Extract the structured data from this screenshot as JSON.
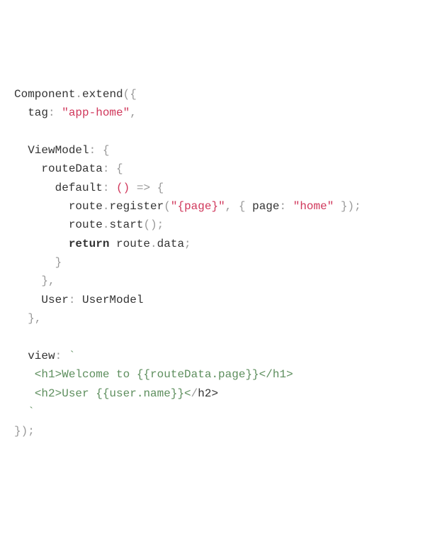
{
  "code": {
    "l1": {
      "a": "Component",
      "b": ".",
      "c": "extend",
      "d": "(",
      "e": "{"
    },
    "l2": {
      "a": "  tag",
      "b": ": ",
      "c": "\"app-home\"",
      "d": ","
    },
    "l3": "",
    "l4": {
      "a": "  ViewModel",
      "b": ": ",
      "c": "{"
    },
    "l5": {
      "a": "    routeData",
      "b": ": ",
      "c": "{"
    },
    "l6": {
      "a": "      default",
      "b": ": ",
      "c": "(",
      "d": ")",
      "e": " ",
      "f": "=>",
      "g": " ",
      "h": "{"
    },
    "l7": {
      "a": "        route",
      "b": ".",
      "c": "register",
      "d": "(",
      "e": "\"{page}\"",
      "f": ",",
      "g": " ",
      "h": "{",
      "i": " page",
      "j": ": ",
      "k": "\"home\"",
      "l": " ",
      "m": "}",
      "n": ")",
      "o": ";"
    },
    "l8": {
      "a": "        route",
      "b": ".",
      "c": "start",
      "d": "(",
      "e": ")",
      "f": ";"
    },
    "l9": {
      "a": "        ",
      "b": "return",
      "c": " route",
      "d": ".",
      "e": "data",
      "f": ";"
    },
    "l10": {
      "a": "      ",
      "b": "}"
    },
    "l11": {
      "a": "    ",
      "b": "}",
      "c": ","
    },
    "l12": {
      "a": "    User",
      "b": ": ",
      "c": "UserModel"
    },
    "l13": {
      "a": "  ",
      "b": "}",
      "c": ","
    },
    "l14": "",
    "l15": {
      "a": "  view",
      "b": ": ",
      "c": "`"
    },
    "l16": {
      "a": "   <h1>Welcome to {{routeData.page}}</h1>"
    },
    "l17": {
      "a": "   ",
      "b": "<h2>",
      "c": "User {{user.name}}",
      "d": "<",
      "e": "/",
      "f": "h2>"
    },
    "l18": {
      "a": "  ",
      "b": "`"
    },
    "l19": {
      "a": "}",
      "b": ")",
      "c": ";"
    }
  }
}
